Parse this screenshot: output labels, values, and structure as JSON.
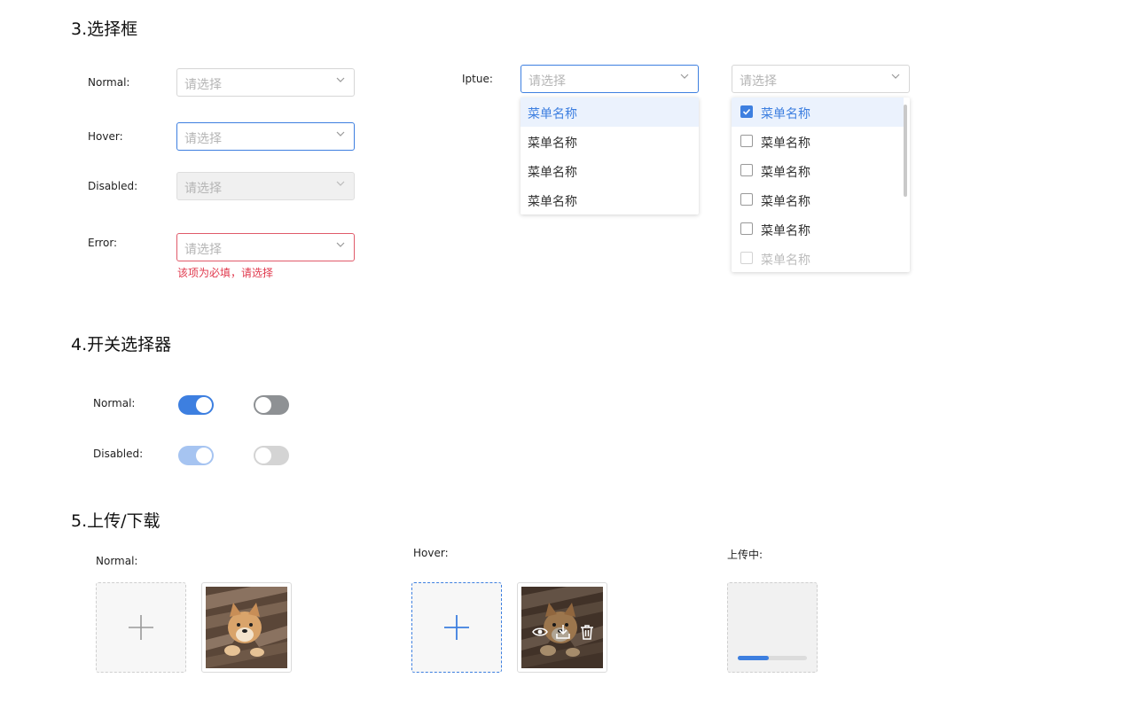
{
  "select_section": {
    "title": "3.选择框",
    "placeholder": "请选择",
    "normal_label": "Normal:",
    "hover_label": "Hover:",
    "disabled_label": "Disabled:",
    "error_label": "Error:",
    "error_message": "该项为必填，请选择",
    "ipute_label": "Iptue:",
    "single_dropdown": {
      "items": [
        {
          "label": "菜单名称",
          "state": "active"
        },
        {
          "label": "菜单名称",
          "state": "normal"
        },
        {
          "label": "菜单名称",
          "state": "normal"
        },
        {
          "label": "菜单名称",
          "state": "normal"
        }
      ]
    },
    "multi_dropdown": {
      "items": [
        {
          "label": "菜单名称",
          "checked": true
        },
        {
          "label": "菜单名称",
          "checked": false
        },
        {
          "label": "菜单名称",
          "checked": false
        },
        {
          "label": "菜单名称",
          "checked": false
        },
        {
          "label": "菜单名称",
          "checked": false
        },
        {
          "label": "菜单名称",
          "checked": false,
          "faded": true
        }
      ]
    }
  },
  "switch_section": {
    "title": "4.开关选择器",
    "normal_label": "Normal:",
    "disabled_label": "Disabled:",
    "switches": {
      "normal_on": true,
      "normal_off": false,
      "disabled_on": true,
      "disabled_off": false
    }
  },
  "upload_section": {
    "title": "5.上传/下载",
    "normal_label": "Normal:",
    "hover_label": "Hover:",
    "uploading_label": "上传中:",
    "upload_progress": 0.45
  },
  "colors": {
    "accent": "#3d7fe0",
    "accent_disabled": "#a6c4f1",
    "switch_off": "#8e9194",
    "switch_off_disabled": "#d4d4d4",
    "error": "#e0394d"
  },
  "icons": {
    "chevron": "chevron-down-icon",
    "plus": "plus-icon",
    "eye": "eye-icon",
    "download": "download-icon",
    "trash": "trash-icon",
    "check": "check-icon"
  }
}
